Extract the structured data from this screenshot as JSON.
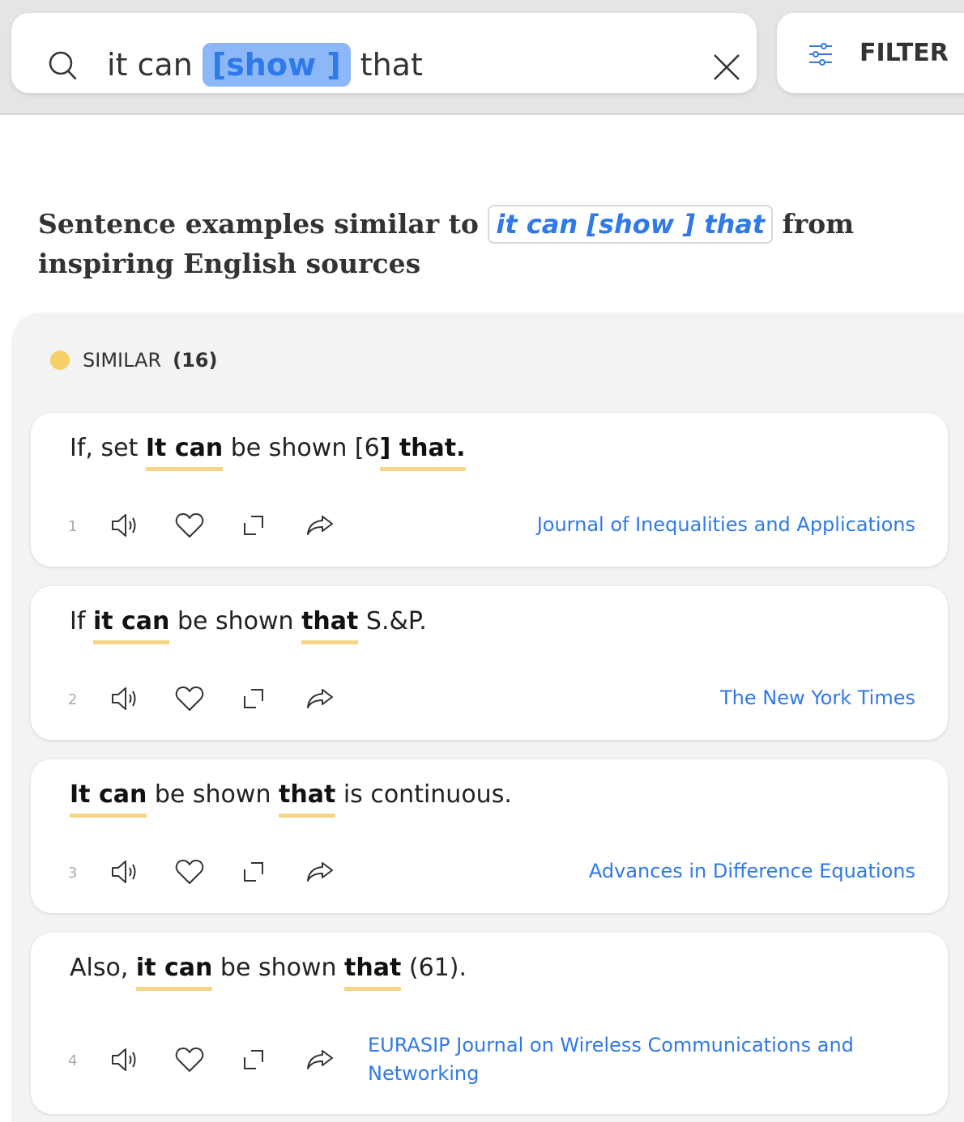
{
  "search": {
    "query_pre": "it can",
    "query_chip": "[show ]",
    "query_post": "that",
    "filter_label": "FILTER"
  },
  "heading": {
    "prefix": "Sentence examples similar to",
    "chip": "it can [show ] that",
    "suffix": "from inspiring English sources"
  },
  "similar": {
    "label": "SIMILAR",
    "count": "(16)"
  },
  "colors": {
    "accent": "#2f79e8",
    "chip_bg": "#8cb8f8",
    "highlight": "#f7d584",
    "dot": "#f7cf68"
  },
  "results": [
    {
      "index": "1",
      "parts": [
        "If, set ",
        "It can",
        " be shown [6",
        "] that.",
        ""
      ],
      "source": "Journal of Inequalities and Applications"
    },
    {
      "index": "2",
      "parts": [
        "If ",
        "it can",
        " be shown ",
        "that",
        " S.&P."
      ],
      "source": "The New York Times"
    },
    {
      "index": "3",
      "parts": [
        "",
        "It can",
        " be shown ",
        "that",
        " is continuous."
      ],
      "source": "Advances in Difference Equations"
    },
    {
      "index": "4",
      "parts": [
        "Also, ",
        "it can",
        " be shown ",
        "that",
        " (61)."
      ],
      "source": "EURASIP Journal on Wireless Communications and Networking"
    }
  ],
  "icons": [
    "search-icon",
    "close-icon",
    "filter-icon",
    "speaker-icon",
    "heart-icon",
    "expand-icon",
    "share-icon"
  ]
}
